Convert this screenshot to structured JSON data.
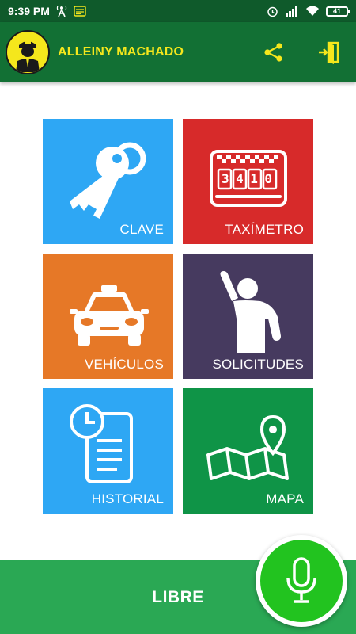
{
  "status_bar": {
    "time": "9:39 PM",
    "battery": "41",
    "icons": [
      "antenna-icon",
      "card-icon",
      "alarm-icon",
      "signal-icon",
      "wifi-icon",
      "battery-icon"
    ]
  },
  "app_bar": {
    "user_name": "ALLEINY MACHADO",
    "avatar_icon": "driver-avatar-icon",
    "share_icon": "share-icon",
    "exit_icon": "exit-door-icon",
    "background": "#127034",
    "title_color": "#f5e71c"
  },
  "tiles": [
    {
      "label": "CLAVE",
      "icon": "keys-icon",
      "color": "#2ea7f4"
    },
    {
      "label": "TAXÍMETRO",
      "icon": "taximeter-icon",
      "color": "#d72a2a"
    },
    {
      "label": "VEHÍCULOS",
      "icon": "taxi-car-icon",
      "color": "#e67827"
    },
    {
      "label": "SOLICITUDES",
      "icon": "raised-hand-person-icon",
      "color": "#463a5f"
    },
    {
      "label": "HISTORIAL",
      "icon": "clock-document-icon",
      "color": "#2ea7f4"
    },
    {
      "label": "MAPA",
      "icon": "map-pin-icon",
      "color": "#0f9447"
    }
  ],
  "taximeter_digits": "3410",
  "bottom_bar": {
    "label": "LIBRE",
    "color": "#2aa854",
    "mic_icon": "microphone-icon",
    "mic_color": "#22c31f"
  }
}
